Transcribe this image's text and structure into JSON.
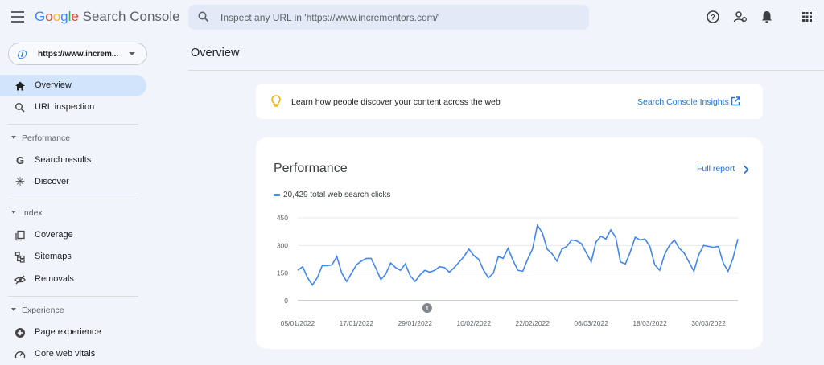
{
  "header": {
    "logo_g": "G",
    "logo_o1": "o",
    "logo_o2": "o",
    "logo_g2": "g",
    "logo_l": "l",
    "logo_e": "e",
    "product": "Search Console",
    "search_placeholder": "Inspect any URL in 'https://www.incrementors.com/'",
    "icons": [
      "hamburger-icon",
      "search-icon",
      "help-icon",
      "manage-users-icon",
      "bell-icon",
      "apps-grid-icon"
    ]
  },
  "sidebar": {
    "property_logo": "Ⓘ",
    "property": "https://www.increm...",
    "items": [
      {
        "label": "Overview",
        "icon": "home-icon",
        "active": true
      },
      {
        "label": "URL inspection",
        "icon": "search-icon"
      }
    ],
    "sections": [
      {
        "label": "Performance",
        "items": [
          {
            "label": "Search results",
            "icon": "google-g-icon"
          },
          {
            "label": "Discover",
            "icon": "asterisk-icon"
          }
        ]
      },
      {
        "label": "Index",
        "items": [
          {
            "label": "Coverage",
            "icon": "copy-icon"
          },
          {
            "label": "Sitemaps",
            "icon": "sitemap-icon"
          },
          {
            "label": "Removals",
            "icon": "eye-off-icon"
          }
        ]
      },
      {
        "label": "Experience",
        "items": [
          {
            "label": "Page experience",
            "icon": "plus-circle-icon"
          },
          {
            "label": "Core web vitals",
            "icon": "gauge-icon"
          }
        ]
      }
    ]
  },
  "main": {
    "title": "Overview",
    "insight": {
      "text": "Learn how people discover your content across the web",
      "link": "Search Console Insights"
    },
    "performance": {
      "title": "Performance",
      "full_report": "Full report",
      "legend": "20,429 total web search clicks",
      "annotation": "1"
    }
  },
  "chart_data": {
    "type": "line",
    "y_ticks": [
      0,
      150,
      300,
      450
    ],
    "ylim": [
      0,
      450
    ],
    "x_ticks": [
      "05/01/2022",
      "17/01/2022",
      "29/01/2022",
      "10/02/2022",
      "22/02/2022",
      "06/03/2022",
      "18/03/2022",
      "30/03/2022"
    ],
    "x_start": "05/01/2022",
    "x_end": "05/04/2022",
    "annotation_date": "29/01/2022",
    "color": "#4285f4",
    "series": [
      {
        "values": [
          165,
          185,
          125,
          85,
          125,
          190,
          190,
          195,
          240,
          150,
          105,
          150,
          195,
          215,
          230,
          230,
          175,
          115,
          145,
          205,
          180,
          165,
          200,
          135,
          105,
          140,
          165,
          155,
          165,
          185,
          180,
          155,
          180,
          210,
          240,
          280,
          245,
          225,
          165,
          125,
          150,
          240,
          230,
          285,
          220,
          165,
          160,
          225,
          280,
          410,
          370,
          280,
          255,
          215,
          280,
          295,
          330,
          325,
          310,
          260,
          210,
          320,
          350,
          335,
          385,
          345,
          210,
          200,
          265,
          345,
          330,
          335,
          295,
          195,
          165,
          250,
          300,
          330,
          285,
          260,
          210,
          160,
          250,
          300,
          295,
          290,
          295,
          205,
          160,
          230,
          335
        ]
      }
    ]
  }
}
